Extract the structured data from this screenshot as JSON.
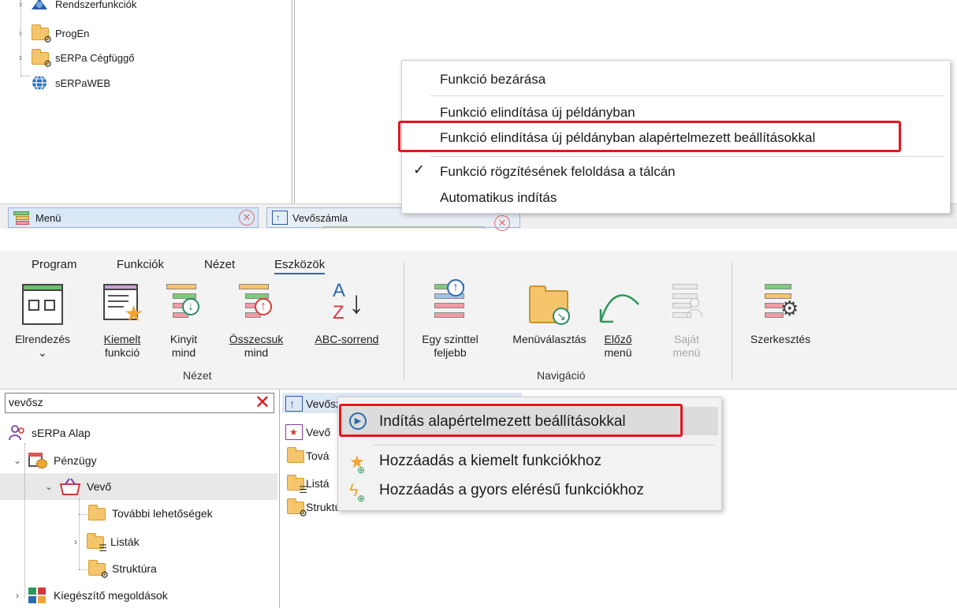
{
  "top_tree": {
    "items": [
      {
        "label": "Rendszerfunkciók",
        "icon": "system-functions-icon"
      },
      {
        "label": "ProgEn",
        "icon": "folder-gear-icon"
      },
      {
        "label": "sERPa Cégfüggő",
        "icon": "folder-gear-icon"
      },
      {
        "label": "sERPaWEB",
        "icon": "globe-icon"
      }
    ]
  },
  "taskbar": {
    "menu_label": "Menü",
    "invoice_label": "Vevőszámla"
  },
  "top_context_menu": {
    "items": [
      "Funkció bezárása",
      "Funkció elindítása új példányban",
      "Funkció elindítása új példányban alapértelmezett beállításokkal",
      "Funkció rögzítésének feloldása a tálcán",
      "Automatikus indítás"
    ],
    "checkmark": "✓"
  },
  "ribbon": {
    "tabs": [
      "Program",
      "Funkciók",
      "Nézet",
      "Eszközök"
    ],
    "active_tab": "Eszközök",
    "buttons": {
      "layout": {
        "line1": "Elrendezés",
        "line2": "⌄"
      },
      "favorite": {
        "line1": "Kiemelt",
        "line2": "funkció"
      },
      "expand": {
        "line1": "Kinyit",
        "line2": "mind"
      },
      "collapse": {
        "line1": "Összecsuk",
        "line2": "mind"
      },
      "abc": {
        "line1": "ABC-sorrend",
        "glyph_a": "A",
        "glyph_z": "Z",
        "arrow": "↓"
      },
      "up_level": {
        "line1": "Egy szinttel",
        "line2": "feljebb"
      },
      "menu_select": {
        "line1": "Menüválasztás"
      },
      "previous": {
        "line1": "Előző",
        "line2": "menü"
      },
      "own": {
        "line1": "Saját",
        "line2": "menü"
      },
      "edit": {
        "line1": "Szerkesztés"
      }
    },
    "groups": {
      "view": "Nézet",
      "navigation": "Navigáció"
    }
  },
  "search": {
    "value": "vevősz",
    "clear": "✕"
  },
  "bottom_tree": {
    "items": [
      {
        "label": "sERPa Alap"
      },
      {
        "label": "Pénzügy"
      },
      {
        "label": "Vevő"
      },
      {
        "label": "További lehetőségek"
      },
      {
        "label": "Listák"
      },
      {
        "label": "Struktúra"
      },
      {
        "label": "Kiegészítő megoldások"
      }
    ]
  },
  "right_list": {
    "items": [
      "Vevőszámla",
      "Vevő",
      "Tová",
      "Listá",
      "Struktúra"
    ]
  },
  "bottom_context_menu": {
    "items": [
      "Indítás alapértelmezett beállításokkal",
      "Hozzáadás a kiemelt funkciókhoz",
      "Hozzáadás a gyors elérésű funkciókhoz"
    ]
  },
  "colors": {
    "highlight": "#e8141c",
    "accent": "#2b6cb0",
    "folder": "#f5c56b"
  }
}
